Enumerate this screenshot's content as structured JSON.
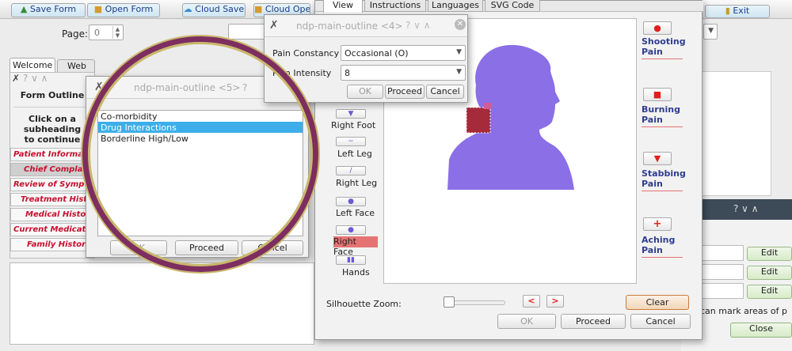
{
  "toolbar": {
    "save_form": "Save Form",
    "open_form": "Open Form",
    "cloud_save": "Cloud Save",
    "cloud_open": "Cloud Ope",
    "exit": "Exit"
  },
  "page": {
    "label": "Page:",
    "value": "0"
  },
  "tabs": {
    "welcome": "Welcome",
    "web": "Web"
  },
  "form_outline": {
    "title": "Form Outline",
    "hint": [
      "Click on a",
      "subheading",
      "to continue"
    ],
    "items": [
      "Patient Informat",
      "Chief Complain",
      "Review of Sympto",
      "Treatment Histo",
      "Medical History",
      "Current Medicatio",
      "Family History"
    ]
  },
  "dialog5": {
    "title": "ndp-main-outline <5>",
    "list": [
      "Co-morbidity",
      "Drug Interactions",
      "Borderline High/Low"
    ],
    "selected_index": 1,
    "ok": "OK",
    "proceed": "Proceed",
    "cancel": "Cancel"
  },
  "dialog4": {
    "title": "ndp-main-outline <4>",
    "constancy_label": "Pain Constancy",
    "constancy_value": "Occasional (O)",
    "intensity_label": "Pain Intensity",
    "intensity_value": "8",
    "ok": "OK",
    "proceed": "Proceed",
    "cancel": "Cancel"
  },
  "silhouette": {
    "tabs": [
      "View",
      "Instructions",
      "Languages",
      "SVG Code"
    ],
    "body_parts": [
      "Right Foot",
      "Left Leg",
      "Right Leg",
      "Left Face",
      "Right Face",
      "Hands"
    ],
    "active_part": "Right Face",
    "pain_types": [
      "Shooting Pain",
      "Burning Pain",
      "Stabbing Pain",
      "Aching Pain"
    ],
    "zoom_label": "Silhouette Zoom:",
    "zoom_level": 0,
    "clear": "Clear",
    "ok": "OK",
    "proceed": "Proceed",
    "cancel": "Cancel",
    "colors": {
      "silhouette": "#8b6fe6",
      "mark": "#a52a3a",
      "highlight": "#e57373"
    }
  },
  "right_panel": {
    "edit": "Edit",
    "note": "can mark areas of p",
    "close": "Close"
  }
}
